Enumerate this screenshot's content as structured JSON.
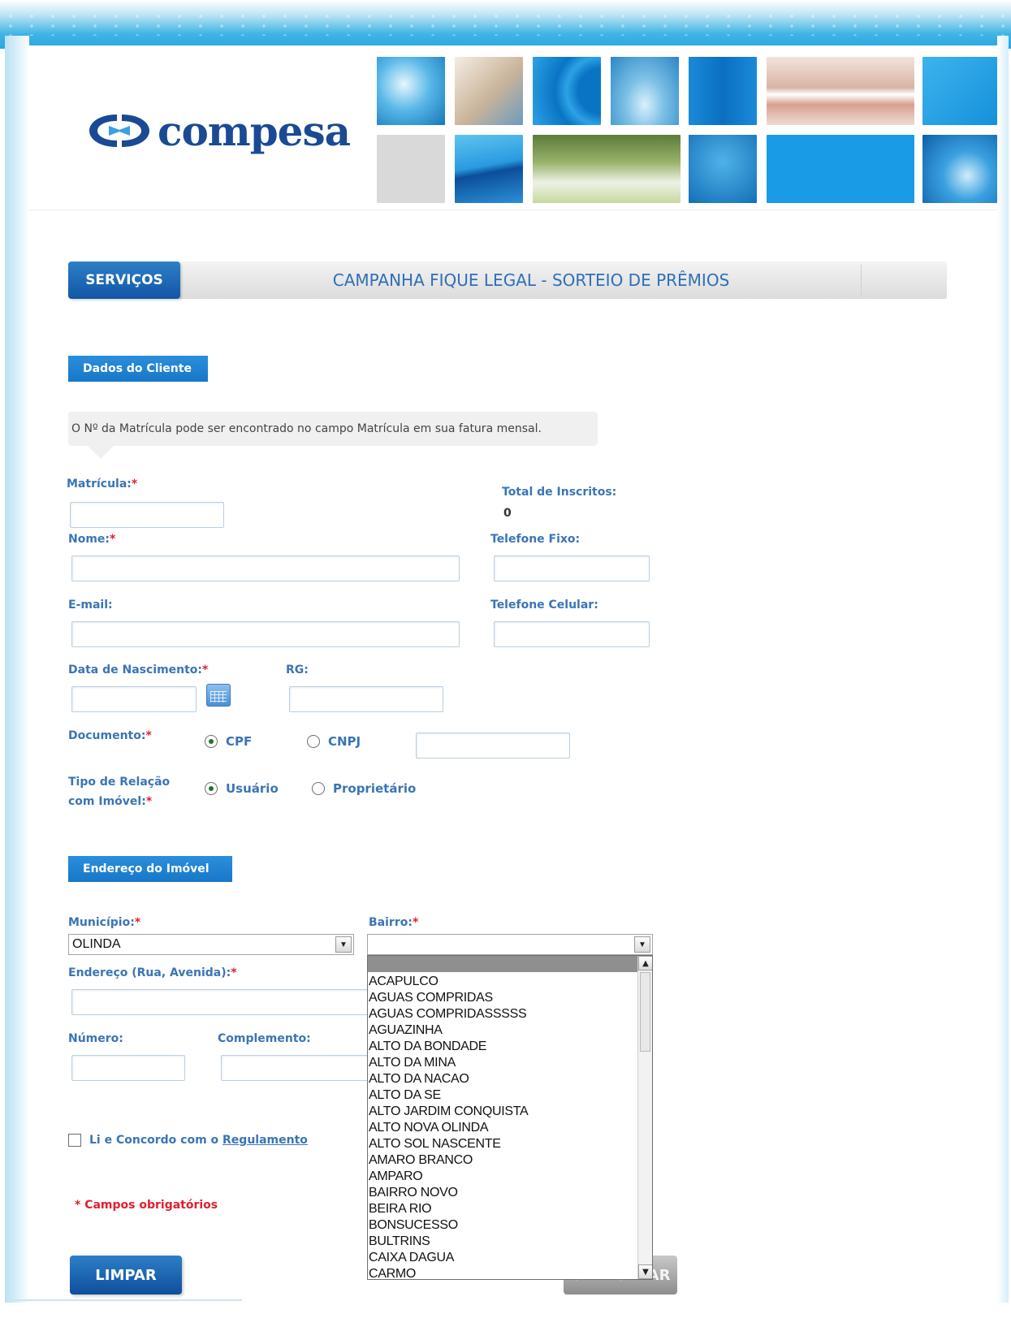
{
  "header": {
    "logo_text": "compesa",
    "services_label": "SERVIÇOS",
    "campaign_title": "CAMPANHA FIQUE LEGAL - SORTEIO DE PRÊMIOS"
  },
  "client_section": {
    "tag": "Dados do Cliente",
    "info": "O Nº da Matrícula pode ser encontrado no campo Matrícula em sua fatura mensal.",
    "matricula_label": "Matrícula:",
    "total_label": "Total de Inscritos:",
    "total_value": "0",
    "nome_label": "Nome:",
    "fixo_label": "Telefone Fixo:",
    "email_label": "E-mail:",
    "celular_label": "Telefone Celular:",
    "nascimento_label": "Data de Nascimento:",
    "rg_label": "RG:",
    "documento_label": "Documento:",
    "cpf_label": "CPF",
    "cnpj_label": "CNPJ",
    "relacao_label_1": "Tipo de Relação",
    "relacao_label_2": "com Imóvel:",
    "usuario_label": "Usuário",
    "proprietario_label": "Proprietário",
    "required_mark": "*"
  },
  "address_section": {
    "tag": "Endereço do Imóvel",
    "municipio_label": "Município:",
    "municipio_value": "OLINDA",
    "bairro_label": "Bairro:",
    "bairro_value": "",
    "endereco_label": "Endereço (Rua, Avenida):",
    "numero_label": "Número:",
    "complemento_label": "Complemento:",
    "bairro_options": [
      "ACAPULCO",
      "AGUAS COMPRIDAS",
      "AGUAS COMPRIDASSSSS",
      "AGUAZINHA",
      "ALTO DA BONDADE",
      "ALTO DA MINA",
      "ALTO DA NACAO",
      "ALTO DA SE",
      "ALTO JARDIM CONQUISTA",
      "ALTO NOVA OLINDA",
      "ALTO SOL NASCENTE",
      "AMARO BRANCO",
      "AMPARO",
      "BAIRRO NOVO",
      "BEIRA RIO",
      "BONSUCESSO",
      "BULTRINS",
      "CAIXA DAGUA",
      "CARMO"
    ]
  },
  "agreement": {
    "text": "Li e Concordo com o ",
    "link": "Regulamento"
  },
  "footnote": "* Campos obrigatórios",
  "buttons": {
    "clear": "LIMPAR",
    "submit": "CADASTRAR"
  },
  "icons": {
    "logo": "compesa-logo-mark",
    "calendar": "calendar-icon",
    "select_arrow": "chevron-down-icon"
  },
  "colors": {
    "brand_blue": "#1a4a94",
    "label_blue": "#3a75b5",
    "required_red": "#e0202c"
  }
}
